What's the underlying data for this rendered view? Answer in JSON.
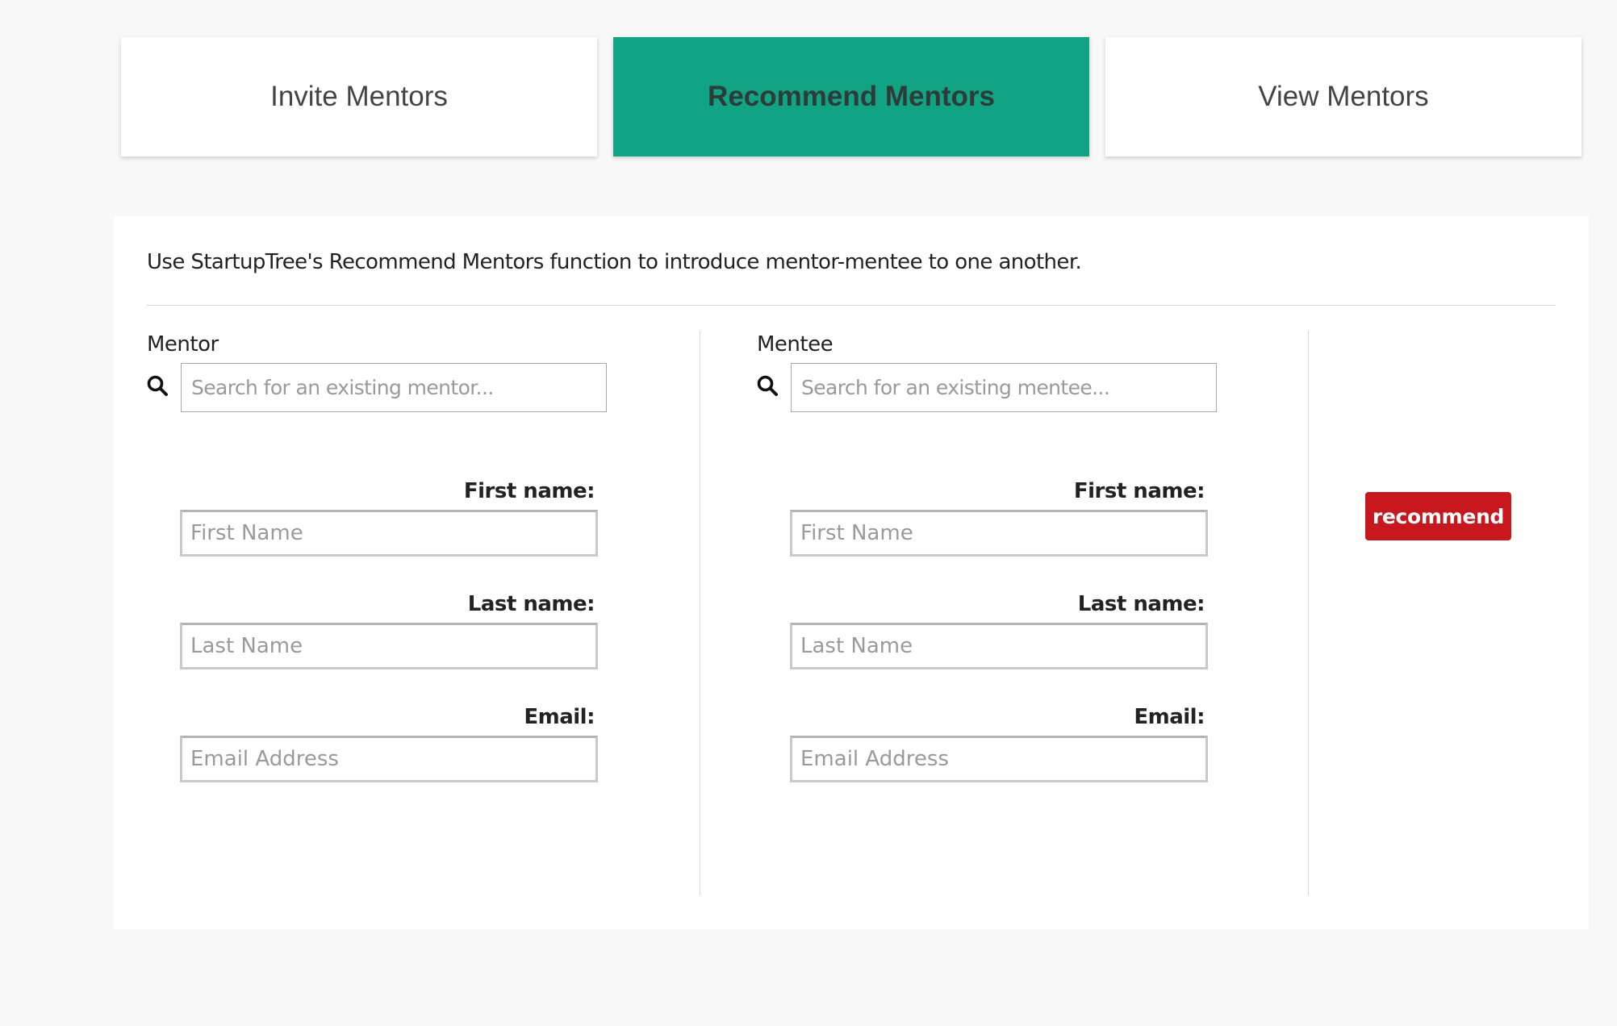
{
  "tabs": [
    {
      "label": "Invite Mentors",
      "active": false
    },
    {
      "label": "Recommend Mentors",
      "active": true
    },
    {
      "label": "View Mentors",
      "active": false
    }
  ],
  "intro_text": "Use StartupTree's Recommend Mentors function to introduce mentor-mentee to one another.",
  "mentor": {
    "heading": "Mentor",
    "search_placeholder": "Search for an existing mentor...",
    "first_name_label": "First name:",
    "first_name_placeholder": "First Name",
    "last_name_label": "Last name:",
    "last_name_placeholder": "Last Name",
    "email_label": "Email:",
    "email_placeholder": "Email Address"
  },
  "mentee": {
    "heading": "Mentee",
    "search_placeholder": "Search for an existing mentee...",
    "first_name_label": "First name:",
    "first_name_placeholder": "First Name",
    "last_name_label": "Last name:",
    "last_name_placeholder": "Last Name",
    "email_label": "Email:",
    "email_placeholder": "Email Address"
  },
  "recommend_button": "recommend",
  "colors": {
    "active_tab": "#10a384",
    "button": "#c8181e",
    "background": "#f8f8f8"
  },
  "icons": [
    "search-icon"
  ]
}
